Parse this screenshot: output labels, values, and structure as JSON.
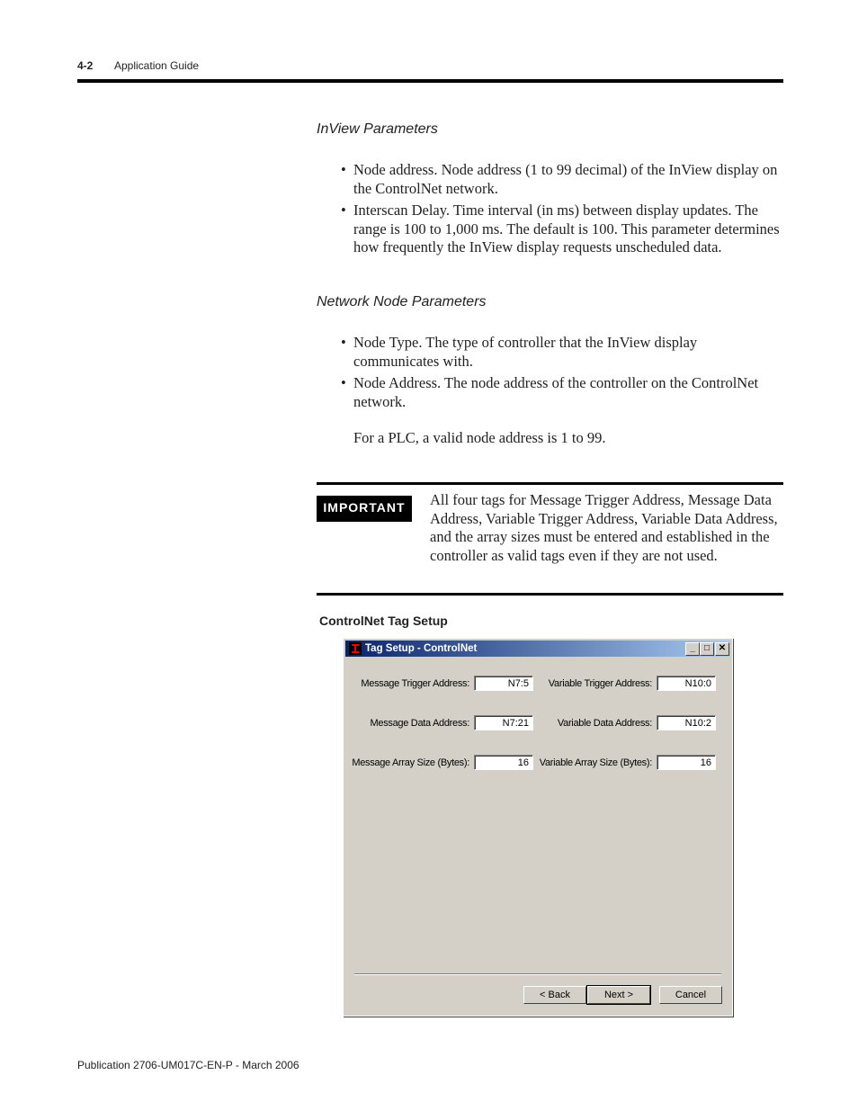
{
  "header": {
    "page_number": "4-2",
    "title": "Application Guide"
  },
  "sections": [
    {
      "heading": "InView Parameters",
      "bullets": [
        "Node address. Node address (1 to 99 decimal) of the InView display on the ControlNet network.",
        "Interscan Delay. Time interval (in ms) between display updates. The range is 100 to 1,000 ms. The default is 100. This parameter determines how frequently the InView display requests unscheduled data."
      ]
    },
    {
      "heading": "Network Node Parameters",
      "bullets": [
        "Node Type. The type of controller that the InView display communicates with.",
        "Node Address. The node address of the controller on the ControlNet network."
      ],
      "note": "For a PLC, a valid node address is 1 to 99."
    }
  ],
  "important": {
    "badge": "IMPORTANT",
    "text": "All four tags for Message Trigger Address, Message Data Address, Variable Trigger Address, Variable Data Address, and the array sizes must be entered and established in the controller as valid tags even if they are not used."
  },
  "figure_caption": "ControlNet Tag Setup",
  "dialog": {
    "title": "Tag Setup - ControlNet",
    "title_buttons": {
      "minimize": "_",
      "maximize": "□",
      "close": "✕"
    },
    "fields": [
      {
        "label": "Message Trigger Address:",
        "value": "N7:5"
      },
      {
        "label": "Variable Trigger Address:",
        "value": "N10:0"
      },
      {
        "label": "Message Data Address:",
        "value": "N7:21"
      },
      {
        "label": "Variable Data Address:",
        "value": "N10:2"
      },
      {
        "label": "Message Array Size (Bytes):",
        "value": "16"
      },
      {
        "label": "Variable Array Size (Bytes):",
        "value": "16"
      }
    ],
    "buttons": {
      "back": "< Back",
      "next": "Next >",
      "cancel": "Cancel"
    }
  },
  "footer": {
    "publication": "Publication 2706-UM017C-EN-P - March 2006"
  }
}
